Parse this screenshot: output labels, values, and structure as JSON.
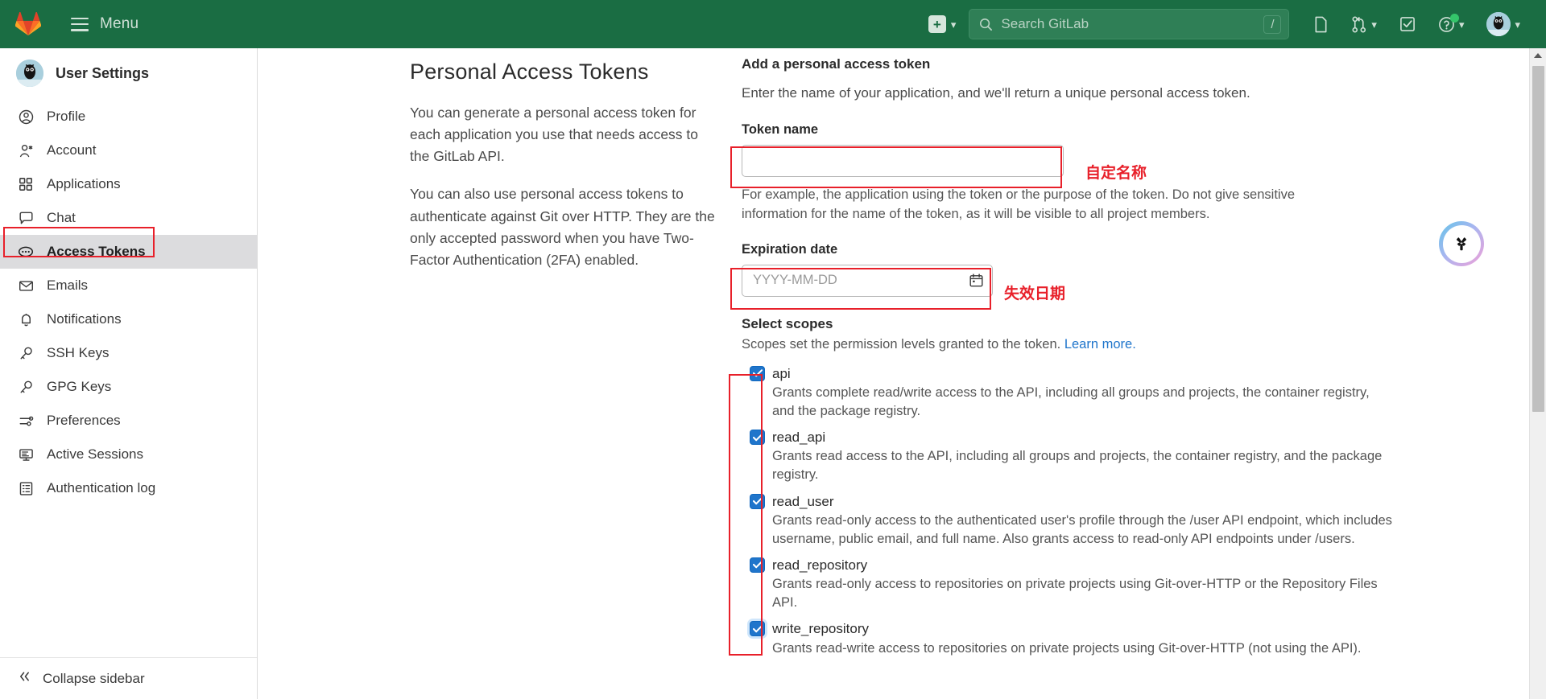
{
  "navbar": {
    "logo_icon": "gitlab-tanuki-logo",
    "hamburger_icon": "hamburger-menu-icon",
    "menu_label": "Menu",
    "plus_icon": "plus-square-icon",
    "plus_chevron_icon": "chevron-down-icon",
    "search_placeholder": "Search GitLab",
    "search_icon": "search-icon",
    "search_shortcut": "/",
    "issues_icon": "issues-icon",
    "merge_requests_icon": "merge-request-icon",
    "merge_requests_chevron": "chevron-down-icon",
    "todos_icon": "todo-checkbox-icon",
    "help_icon": "help-question-icon",
    "help_chevron": "chevron-down-icon",
    "avatar_icon": "user-avatar",
    "avatar_chevron": "chevron-down-icon"
  },
  "sidebar": {
    "title": "User Settings",
    "avatar_icon": "user-avatar",
    "items": [
      {
        "label": "Profile",
        "icon": "profile-user-icon",
        "active": false
      },
      {
        "label": "Account",
        "icon": "account-user-gear-icon",
        "active": false
      },
      {
        "label": "Applications",
        "icon": "applications-grid-icon",
        "active": false
      },
      {
        "label": "Chat",
        "icon": "chat-bubble-icon",
        "active": false
      },
      {
        "label": "Access Tokens",
        "icon": "access-token-icon",
        "active": true
      },
      {
        "label": "Emails",
        "icon": "envelope-icon",
        "active": false
      },
      {
        "label": "Notifications",
        "icon": "bell-icon",
        "active": false
      },
      {
        "label": "SSH Keys",
        "icon": "key-icon",
        "active": false
      },
      {
        "label": "GPG Keys",
        "icon": "key-icon",
        "active": false
      },
      {
        "label": "Preferences",
        "icon": "sliders-icon",
        "active": false
      },
      {
        "label": "Active Sessions",
        "icon": "monitor-icon",
        "active": false
      },
      {
        "label": "Authentication log",
        "icon": "log-list-icon",
        "active": false
      }
    ],
    "collapse_label": "Collapse sidebar",
    "collapse_icon": "double-chevron-left-icon"
  },
  "main": {
    "page_title": "Personal Access Tokens",
    "description_paragraph_1": "You can generate a personal access token for each application you use that needs access to the GitLab API.",
    "description_paragraph_2": "You can also use personal access tokens to authenticate against Git over HTTP. They are the only accepted password when you have Two-Factor Authentication (2FA) enabled.",
    "form": {
      "heading": "Add a personal access token",
      "subheading": "Enter the name of your application, and we'll return a unique personal access token.",
      "token_name_label": "Token name",
      "token_name_value": "",
      "token_name_placeholder": "",
      "token_name_help": "For example, the application using the token or the purpose of the token. Do not give sensitive information for the name of the token, as it will be visible to all project members.",
      "expiration_label": "Expiration date",
      "expiration_value": "",
      "expiration_placeholder": "YYYY-MM-DD",
      "calendar_icon": "calendar-icon"
    },
    "scopes": {
      "heading": "Select scopes",
      "subtext": "Scopes set the permission levels granted to the token.",
      "learn_more_label": "Learn more.",
      "items": [
        {
          "name": "api",
          "checked": true,
          "focused": false,
          "description": "Grants complete read/write access to the API, including all groups and projects, the container registry, and the package registry."
        },
        {
          "name": "read_api",
          "checked": true,
          "focused": false,
          "description": "Grants read access to the API, including all groups and projects, the container registry, and the package registry."
        },
        {
          "name": "read_user",
          "checked": true,
          "focused": false,
          "description": "Grants read-only access to the authenticated user's profile through the /user API endpoint, which includes username, public email, and full name. Also grants access to read-only API endpoints under /users."
        },
        {
          "name": "read_repository",
          "checked": true,
          "focused": false,
          "description": "Grants read-only access to repositories on private projects using Git-over-HTTP or the Repository Files API."
        },
        {
          "name": "write_repository",
          "checked": true,
          "focused": true,
          "description": "Grants read-write access to repositories on private projects using Git-over-HTTP (not using the API)."
        }
      ]
    }
  },
  "annotations": {
    "color": "#e8202a",
    "token_name_note": "自定名称",
    "expiration_note": "失效日期"
  },
  "float_widget": {
    "icon": "tri-blade-widget-icon"
  },
  "scrollbar": {
    "up_arrow_icon": "scroll-up-arrow-icon"
  }
}
